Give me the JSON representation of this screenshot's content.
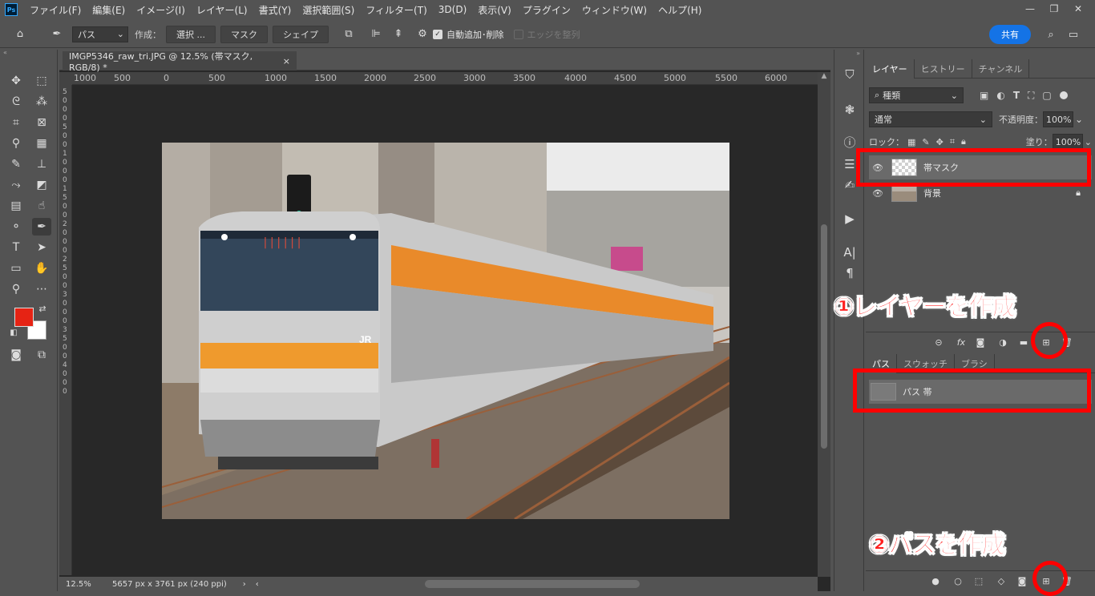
{
  "menubar": {
    "logo": "Ps",
    "items": [
      "ファイル(F)",
      "編集(E)",
      "イメージ(I)",
      "レイヤー(L)",
      "書式(Y)",
      "選択範囲(S)",
      "フィルター(T)",
      "3D(D)",
      "表示(V)",
      "プラグイン",
      "ウィンドウ(W)",
      "ヘルプ(H)"
    ],
    "win_min": "—",
    "win_restore": "❐",
    "win_close": "✕"
  },
  "options": {
    "mode": "パス",
    "make_label": "作成：",
    "select_btn": "選択 ...",
    "mask_btn": "マスク",
    "shape_btn": "シェイプ",
    "auto_add_delete": "自動追加･削除",
    "align_edges": "エッジを整列",
    "share": "共有"
  },
  "document": {
    "tab_title": "IMGP5346_raw_tri.JPG @ 12.5% (帯マスク, RGB/8) *",
    "zoom": "12.5%",
    "doc_info": "5657 px x 3761 px (240 ppi)",
    "ruler_labels": [
      "1000",
      "500",
      "0",
      "500",
      "1000",
      "1500",
      "2000",
      "2500",
      "3000",
      "3500",
      "4000",
      "4500",
      "5000",
      "5500",
      "6000"
    ],
    "ruler_v": "5 0 0 0 5 0 0 1 0 0 0 1 5 0 0 2 0 0 0 2 5 0 0 3 0 0 0 3 5 0 0 4 0 0 0"
  },
  "layers_panel": {
    "tabs": [
      "レイヤー",
      "ヒストリー",
      "チャンネル"
    ],
    "kind": "種類",
    "blend": "通常",
    "opacity_label": "不透明度：",
    "opacity": "100%",
    "lock_label": "ロック：",
    "fill_label": "塗り：",
    "fill": "100%",
    "layers": [
      {
        "name": "帯マスク"
      },
      {
        "name": "背景"
      }
    ]
  },
  "paths_panel": {
    "tabs": [
      "パス",
      "スウォッチ",
      "ブラシ"
    ],
    "paths": [
      {
        "name": "パス 帯"
      }
    ]
  },
  "annotations": {
    "step1": "①レイヤーを作成",
    "step2": "②パスを作成"
  },
  "colors": {
    "foreground": "#e62314",
    "background": "#ffffff",
    "annotation": "#ff0000",
    "share": "#1473e6"
  }
}
